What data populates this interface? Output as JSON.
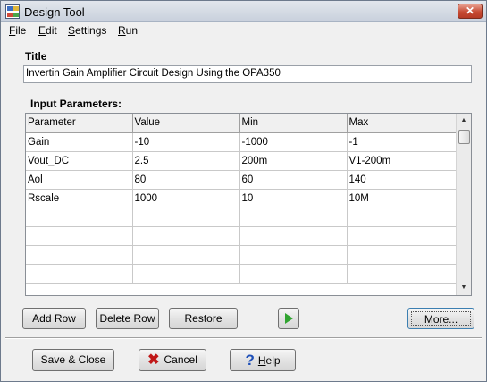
{
  "window": {
    "title": "Design Tool",
    "close_label": "✕"
  },
  "menu": [
    {
      "label": "File"
    },
    {
      "label": "Edit"
    },
    {
      "label": "Settings"
    },
    {
      "label": "Run"
    }
  ],
  "form": {
    "title_label": "Title",
    "title_value": "Invertin Gain Amplifier Circuit Design Using the OPA350",
    "input_params_label": "Input Parameters:"
  },
  "grid": {
    "columns": [
      "Parameter",
      "Value",
      "Min",
      "Max"
    ],
    "rows": [
      [
        "Gain",
        "-10",
        "-1000",
        "-1"
      ],
      [
        "Vout_DC",
        "2.5",
        "200m",
        "V1-200m"
      ],
      [
        "Aol",
        "80",
        "60",
        "140"
      ],
      [
        "Rscale",
        "1000",
        "10",
        "10M"
      ],
      [
        "",
        "",
        "",
        ""
      ],
      [
        "",
        "",
        "",
        ""
      ],
      [
        "",
        "",
        "",
        ""
      ],
      [
        "",
        "",
        "",
        ""
      ]
    ]
  },
  "buttons": {
    "add_row": "Add Row",
    "delete_row": "Delete Row",
    "restore": "Restore",
    "more": "More...",
    "save_close": "Save & Close",
    "cancel": "Cancel",
    "help": "Help"
  },
  "colors": {
    "run_icon": "#2fa32f",
    "cancel_icon": "#c01818",
    "help_icon": "#1d4fb8"
  }
}
